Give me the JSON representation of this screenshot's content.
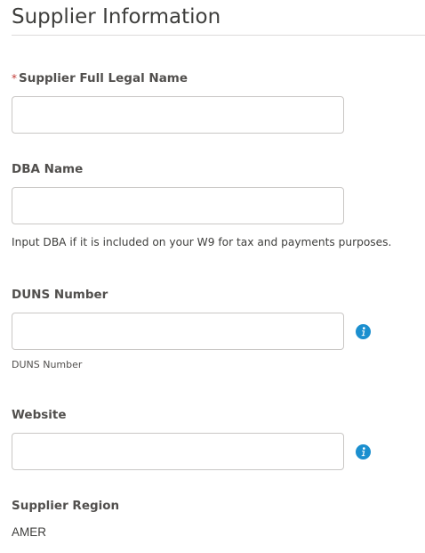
{
  "section": {
    "title": "Supplier Information"
  },
  "fields": {
    "legal_name": {
      "required_marker": "*",
      "label": "Supplier Full Legal Name",
      "value": ""
    },
    "dba_name": {
      "label": "DBA Name",
      "value": "",
      "help_text": "Input DBA if it is included on your W9 for tax and payments purposes."
    },
    "duns_number": {
      "label": "DUNS Number",
      "value": "",
      "sub_help": "DUNS Number",
      "info_icon": "info-icon"
    },
    "website": {
      "label": "Website",
      "value": "",
      "info_icon": "info-icon"
    },
    "supplier_region": {
      "label": "Supplier Region",
      "value": "AMER"
    }
  },
  "colors": {
    "info_icon": "#1b8fcf",
    "required": "#c23934",
    "border": "#c9c7c5"
  }
}
